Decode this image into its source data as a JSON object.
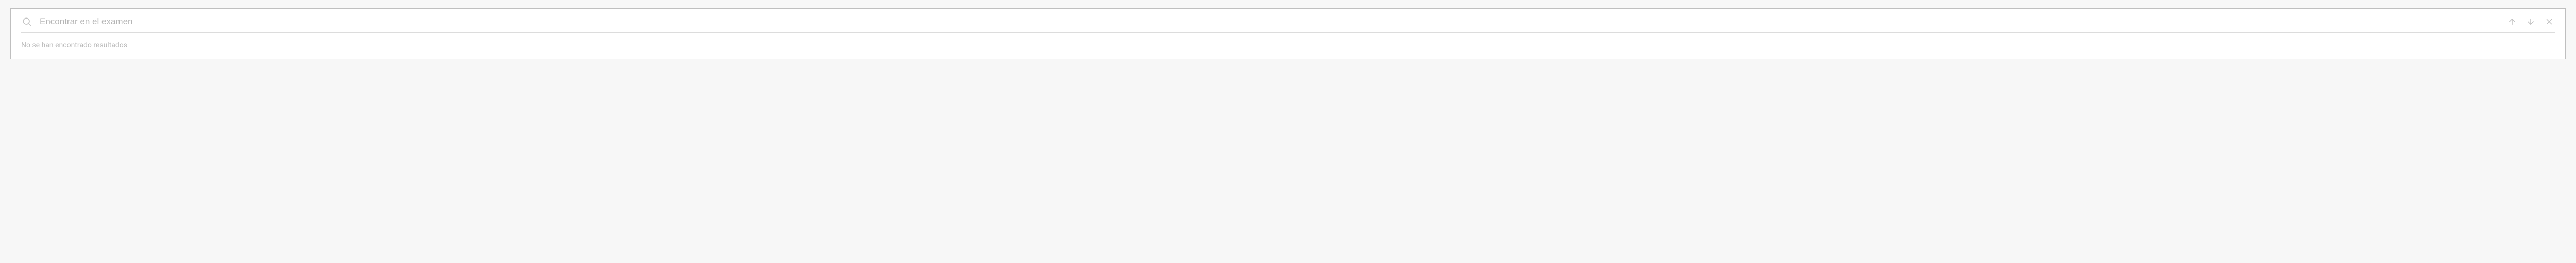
{
  "search": {
    "placeholder": "Encontrar en el examen",
    "value": ""
  },
  "status": {
    "no_results": "No se han encontrado resultados"
  }
}
